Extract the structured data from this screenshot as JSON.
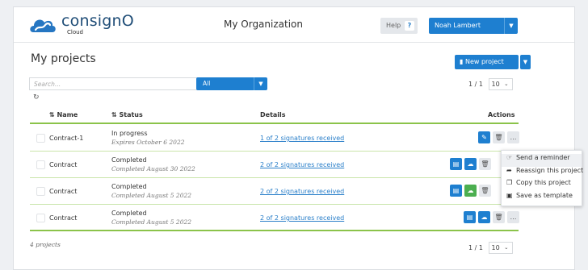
{
  "header": {
    "brand": "consignO",
    "brand_sub": "Cloud",
    "org": "My Organization",
    "help_label": "Help",
    "help_icon": "?",
    "user_name": "Noah Lambert"
  },
  "page": {
    "title": "My projects",
    "new_project_label": "New project",
    "search_placeholder": "Search...",
    "filter_value": "All",
    "pager_top": {
      "current": "1",
      "sep": "/",
      "total": "1",
      "per_page": "10"
    },
    "pager_bottom": {
      "current": "1",
      "sep": "/",
      "total": "1",
      "per_page": "10"
    },
    "count": "4 projects"
  },
  "table": {
    "headers": {
      "name": "Name",
      "status": "Status",
      "details": "Details",
      "actions": "Actions"
    },
    "sort_icon": "⇅",
    "rows": [
      {
        "name": "Contract-1",
        "status": "In progress",
        "status_sub": "Expires October 6 2022",
        "details": "1 of 2 signatures received"
      },
      {
        "name": "Contract",
        "status": "Completed",
        "status_sub": "Completed August 30 2022",
        "details": "2 of 2 signatures received"
      },
      {
        "name": "Contract",
        "status": "Completed",
        "status_sub": "Completed August 5 2022",
        "details": "2 of 2 signatures received"
      },
      {
        "name": "Contract",
        "status": "Completed",
        "status_sub": "Completed August 5 2022",
        "details": "2 of 2 signatures received"
      }
    ]
  },
  "actions_menu": {
    "items": [
      {
        "label": "Send a reminder",
        "icon": "hand-point-icon"
      },
      {
        "label": "Reassign this project",
        "icon": "share-arrow-icon"
      },
      {
        "label": "Copy this project",
        "icon": "copy-icon"
      },
      {
        "label": "Save as template",
        "icon": "template-icon"
      }
    ]
  },
  "colors": {
    "primary": "#1e7fd0",
    "success": "#4caf50",
    "row_divider": "#8bc34a",
    "link": "#2a7fc9"
  }
}
